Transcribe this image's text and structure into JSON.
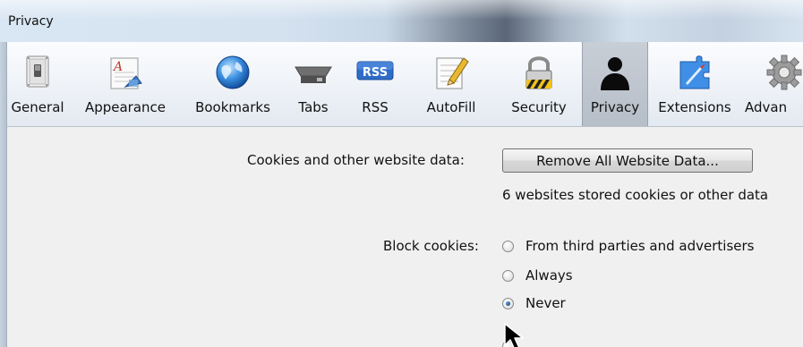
{
  "window": {
    "title": "Privacy"
  },
  "toolbar": {
    "items": [
      {
        "label": "General",
        "icon": "general-switch-icon",
        "selected": false
      },
      {
        "label": "Appearance",
        "icon": "appearance-font-icon",
        "selected": false
      },
      {
        "label": "Bookmarks",
        "icon": "bookmarks-globe-icon",
        "selected": false
      },
      {
        "label": "Tabs",
        "icon": "tabs-icon",
        "selected": false
      },
      {
        "label": "RSS",
        "icon": "rss-icon",
        "selected": false
      },
      {
        "label": "AutoFill",
        "icon": "autofill-pencil-icon",
        "selected": false
      },
      {
        "label": "Security",
        "icon": "security-lock-icon",
        "selected": false
      },
      {
        "label": "Privacy",
        "icon": "privacy-person-icon",
        "selected": true
      },
      {
        "label": "Extensions",
        "icon": "extensions-icon",
        "selected": false
      },
      {
        "label": "Advan",
        "icon": "advanced-gear-icon",
        "selected": false
      }
    ],
    "rss_badge": "RSS"
  },
  "privacy": {
    "cookies_label": "Cookies and other website data:",
    "remove_button": "Remove All Website Data...",
    "stored_info": "6 websites stored cookies or other data",
    "block_cookies_label": "Block cookies:",
    "block_options": [
      {
        "label": "From third parties and advertisers",
        "checked": false
      },
      {
        "label": "Always",
        "checked": false
      },
      {
        "label": "Never",
        "checked": true
      }
    ]
  },
  "colors": {
    "selected_tab_bg": "#bcc4cd",
    "content_bg": "#f0f0f0",
    "radio_checked": "#1e4f8c"
  }
}
